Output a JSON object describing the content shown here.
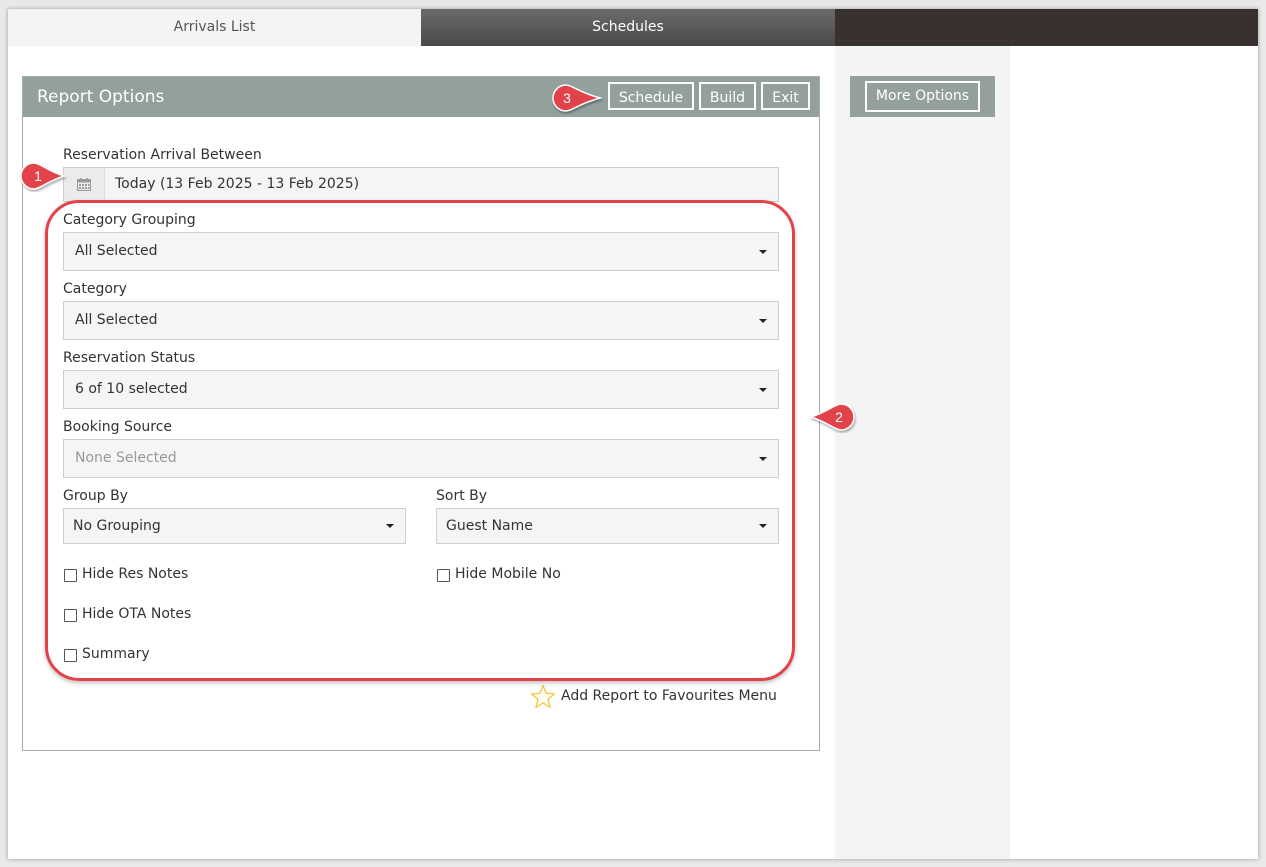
{
  "tabs": [
    {
      "label": "Arrivals List",
      "active": true
    },
    {
      "label": "Schedules",
      "active": false
    }
  ],
  "report_options": {
    "title": "Report Options",
    "buttons": {
      "schedule": "Schedule",
      "build": "Build",
      "exit": "Exit"
    }
  },
  "form": {
    "arrival_between": {
      "label": "Reservation Arrival Between",
      "value": "Today (13 Feb 2025 - 13 Feb 2025)",
      "icon": "calendar-icon"
    },
    "category_grouping": {
      "label": "Category Grouping",
      "value": "All Selected"
    },
    "category": {
      "label": "Category",
      "value": "All Selected"
    },
    "reservation_status": {
      "label": "Reservation Status",
      "value": "6 of 10 selected"
    },
    "booking_source": {
      "label": "Booking Source",
      "value": "None Selected"
    },
    "group_by": {
      "label": "Group By",
      "value": "No Grouping"
    },
    "sort_by": {
      "label": "Sort By",
      "value": "Guest Name"
    },
    "checkboxes": {
      "hide_res_notes": {
        "label": "Hide Res Notes",
        "checked": false
      },
      "hide_mobile_no": {
        "label": "Hide Mobile No",
        "checked": false
      },
      "hide_ota_notes": {
        "label": "Hide OTA Notes",
        "checked": false
      },
      "summary": {
        "label": "Summary",
        "checked": false
      }
    }
  },
  "favourites": {
    "label": "Add Report to Favourites Menu",
    "icon": "star-icon"
  },
  "side": {
    "more_options": "More Options"
  },
  "callouts": {
    "one": "1",
    "two": "2",
    "three": "3"
  },
  "colors": {
    "header": "#93a09e",
    "callout": "#e2434b",
    "tab_dark": "#393130",
    "star": "#f3c63e"
  }
}
